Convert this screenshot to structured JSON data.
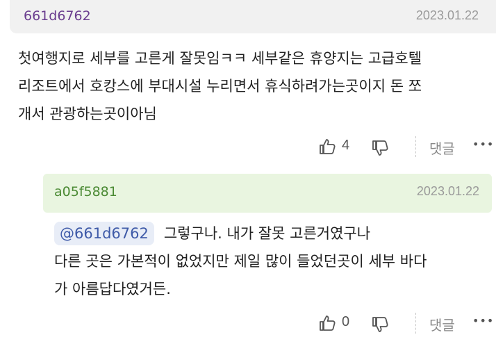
{
  "comment": {
    "author": "661d6762",
    "date": "2023.01.22",
    "text_lines": [
      "첫여행지로 세부를 고른게 잘못임ㅋㅋ 세부같은 휴양지는 고급호텔",
      "리조트에서 호캉스에 부대시설 누리면서 휴식하려가는곳이지 돈 쪼",
      "개서 관광하는곳이아님"
    ],
    "like_count": "4",
    "reply_label": "댓글",
    "more_label": "•••"
  },
  "reply": {
    "author": "a05f5881",
    "date": "2023.01.22",
    "mention": "@661d6762",
    "text_lines": [
      "그렇구나. 내가 잘못 고른거였구나",
      "다른 곳은 가본적이 없었지만 제일 많이 들었던곳이 세부 바다",
      "가 아름답다였거든."
    ],
    "like_count": "0",
    "reply_label": "댓글",
    "more_label": "•••"
  },
  "icons": {
    "like": "thumbs-up-icon",
    "dislike": "thumbs-down-icon",
    "more": "more-dots-icon"
  }
}
